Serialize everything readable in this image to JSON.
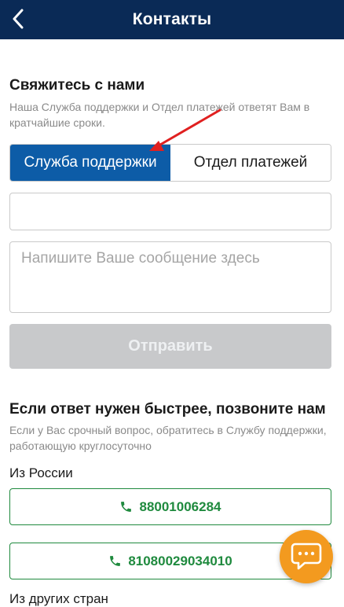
{
  "header": {
    "title": "Контакты",
    "back_icon": "chevron-left-icon"
  },
  "contact": {
    "title": "Свяжитесь с нами",
    "subtitle": "Наша Служба поддержки и Отдел платежей ответят Вам в кратчайшие сроки.",
    "tabs": [
      {
        "label": "Служба поддержки",
        "active": true
      },
      {
        "label": "Отдел платежей",
        "active": false
      }
    ],
    "subject_value": "",
    "message_placeholder": "Напишите Ваше сообщение здесь",
    "send_label": "Отправить"
  },
  "call": {
    "title": "Если ответ нужен быстрее, позвоните нам",
    "subtitle": "Если у Вас срочный вопрос, обратитесь в Службу поддержки, работающую круглосуточно",
    "russia_label": "Из России",
    "phones": [
      {
        "number": "88001006284",
        "icon": "phone-icon"
      },
      {
        "number": "81080029034010",
        "icon": "phone-icon"
      }
    ],
    "other_label": "Из других стран"
  },
  "chat_button_icon": "chat-bubble-icon",
  "colors": {
    "header_bg": "#0a2a56",
    "tab_active_bg": "#0d5ca7",
    "send_disabled_bg": "#c8c9cb",
    "phone_green": "#1f8a3e",
    "chat_orange": "#f39a1f",
    "annotation_red": "#e02020"
  }
}
